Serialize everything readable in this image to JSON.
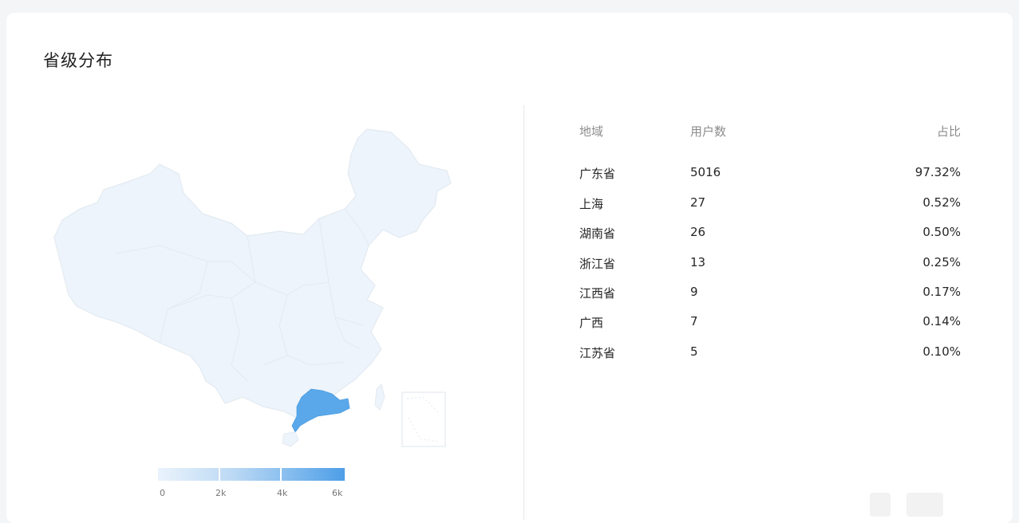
{
  "panel": {
    "title": "省级分布"
  },
  "table": {
    "headers": {
      "region": "地域",
      "users": "用户数",
      "ratio": "占比"
    },
    "rows": [
      {
        "region": "广东省",
        "users": "5016",
        "ratio": "97.32%"
      },
      {
        "region": "上海",
        "users": "27",
        "ratio": "0.52%"
      },
      {
        "region": "湖南省",
        "users": "26",
        "ratio": "0.50%"
      },
      {
        "region": "浙江省",
        "users": "13",
        "ratio": "0.25%"
      },
      {
        "region": "江西省",
        "users": "9",
        "ratio": "0.17%"
      },
      {
        "region": "广西",
        "users": "7",
        "ratio": "0.14%"
      },
      {
        "region": "江苏省",
        "users": "5",
        "ratio": "0.10%"
      }
    ]
  },
  "legend": {
    "labels": [
      "0",
      "2k",
      "4k",
      "6k"
    ],
    "min_color": "#eaf3fc",
    "max_color": "#4e9ee7"
  },
  "map": {
    "base_color": "#edf4fb",
    "border_color": "#e3eaf1",
    "highlight_color": "#5aa8ea",
    "highlight_region": "广东省"
  }
}
